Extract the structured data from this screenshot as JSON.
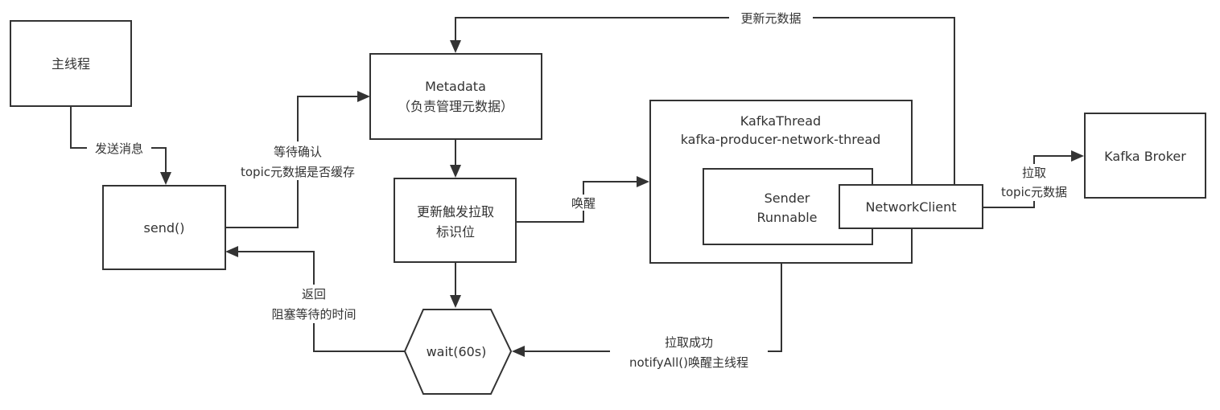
{
  "nodes": {
    "main_thread": "主线程",
    "send": "send()",
    "metadata": {
      "line1": "Metadata",
      "line2": "（负责管理元数据）"
    },
    "update_flag": {
      "line1": "更新触发拉取",
      "line2": "标识位"
    },
    "wait": "wait(60s)",
    "kafka_thread": {
      "line1": "KafkaThread",
      "line2": "kafka-producer-network-thread"
    },
    "sender": {
      "line1": "Sender",
      "line2": "Runnable"
    },
    "network_client": "NetworkClient",
    "kafka_broker": "Kafka Broker"
  },
  "edges": {
    "send_message": "发送消息",
    "wait_confirm": {
      "line1": "等待确认",
      "line2": "topic元数据是否缓存"
    },
    "wake_up": "唤醒",
    "update_metadata": "更新元数据",
    "fetch_topic": {
      "line1": "拉取",
      "line2": "topic元数据"
    },
    "return_wait": {
      "line1": "返回",
      "line2": "阻塞等待的时间"
    },
    "fetch_success": {
      "line1": "拉取成功",
      "line2": "notifyAll()唤醒主线程"
    }
  }
}
